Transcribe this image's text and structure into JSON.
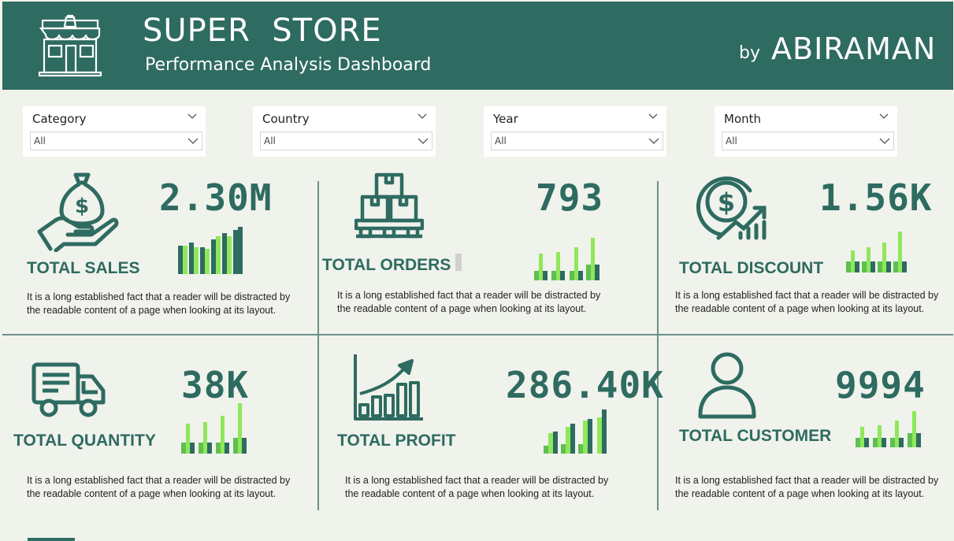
{
  "header": {
    "title": "SUPER  STORE",
    "subtitle": "Performance Analysis Dashboard",
    "by": "by",
    "author": "ABIRAMAN",
    "bg_color": "#2e6b60"
  },
  "filters": [
    {
      "label": "Category",
      "value": "All"
    },
    {
      "label": "Country",
      "value": "All"
    },
    {
      "label": "Year",
      "value": "All"
    },
    {
      "label": "Month",
      "value": "All"
    }
  ],
  "cards": {
    "sales": {
      "value": "2.30M",
      "label": "TOTAL SALES",
      "icon": "money-bag-hand-icon",
      "desc": "It is a long established fact that a reader will be distracted by the readable content of a page when looking at its layout."
    },
    "orders": {
      "value": "793",
      "label": "TOTAL ORDERS",
      "icon": "boxes-pallet-icon",
      "desc": "It is a long established fact that a reader will be distracted by the readable content of a page when looking at its layout."
    },
    "discount": {
      "value": "1.56K",
      "label": "TOTAL DISCOUNT",
      "icon": "dollar-growth-icon",
      "desc": "It is a long established fact that a reader will be distracted by the readable content of a page when looking at its layout."
    },
    "quantity": {
      "value": "38K",
      "label": "TOTAL QUANTITY",
      "icon": "truck-icon",
      "desc": "It is a long established fact that a reader will be distracted by the readable content of a page when looking at its layout."
    },
    "profit": {
      "value": "286.40K",
      "label": "TOTAL PROFIT",
      "icon": "profit-chart-icon",
      "desc": "It is a long established fact that a reader will be distracted by the readable content of a page when looking at its layout."
    },
    "customer": {
      "value": "9994",
      "label": "TOTAL CUSTOMER",
      "icon": "user-icon",
      "desc": "It is a long established fact that a reader will be distracted by the readable content of a page when looking at its layout."
    }
  },
  "colors": {
    "accent": "#2e6b60",
    "bar_light": "#8ee85a",
    "bar_mid": "#5fbf50",
    "bar_dark": "#2e6b60",
    "bar_grey": "#a8a8a8"
  }
}
